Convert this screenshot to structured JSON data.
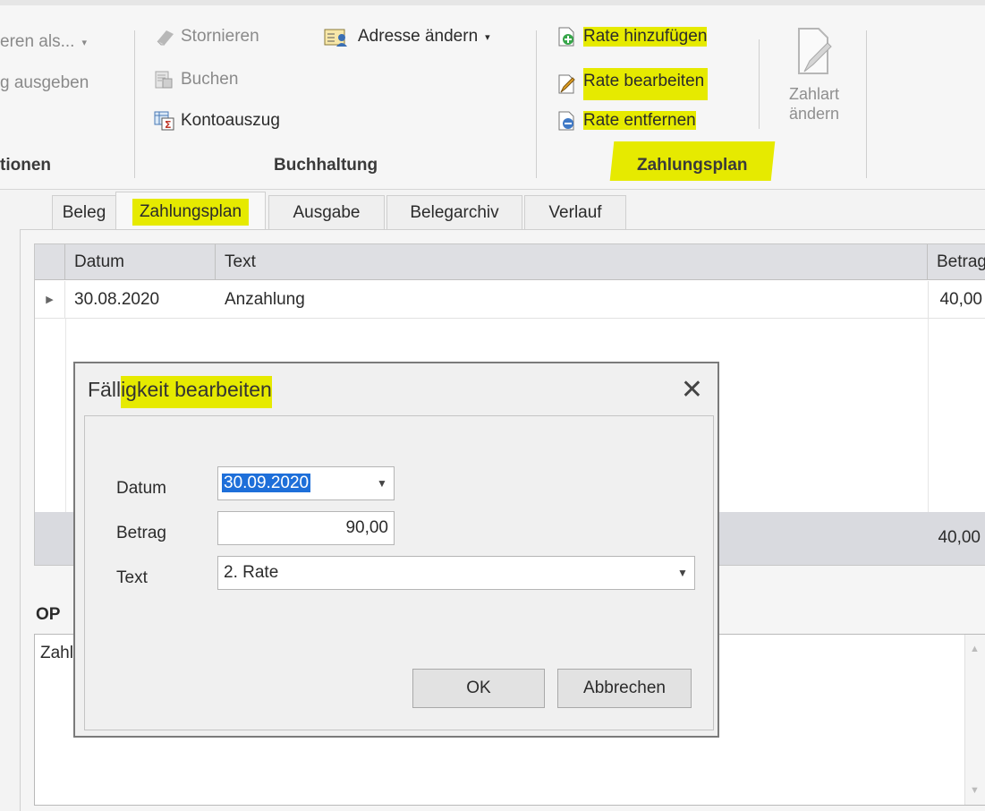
{
  "ribbon": {
    "export_as": "eren als...",
    "output": "g ausgeben",
    "group_actions": "tionen",
    "cancel": "Stornieren",
    "book": "Buchen",
    "statement": "Kontoauszug",
    "change_address": "Adresse ändern",
    "group_accounting": "Buchhaltung",
    "add_rate": "Rate hinzufügen",
    "edit_rate": "Rate bearbeiten",
    "remove_rate": "Rate entfernen",
    "change_payment_line1": "Zahlart",
    "change_payment_line2": "ändern",
    "group_payment_plan": "Zahlungsplan",
    "highlight_color": "#e6ea00"
  },
  "tabs": [
    "Beleg",
    "Zahlungsplan",
    "Ausgabe",
    "Belegarchiv",
    "Verlauf"
  ],
  "grid": {
    "columns": {
      "date": "Datum",
      "text": "Text",
      "amount": "Betrag"
    },
    "rows": [
      {
        "date": "30.08.2020",
        "text": "Anzahlung",
        "amount": "40,00"
      }
    ],
    "footer_total": "40,00"
  },
  "op": {
    "label": "OP",
    "content": "Zahl"
  },
  "dialog": {
    "title_part1": "Fäll",
    "title_part2": "igkeit bearbeiten",
    "close": "✕",
    "date_label": "Datum",
    "date_value": "30.09.2020",
    "amount_label": "Betrag",
    "amount_value": "90,00",
    "text_label": "Text",
    "text_value": "2. Rate",
    "ok": "OK",
    "cancel": "Abbrechen"
  }
}
